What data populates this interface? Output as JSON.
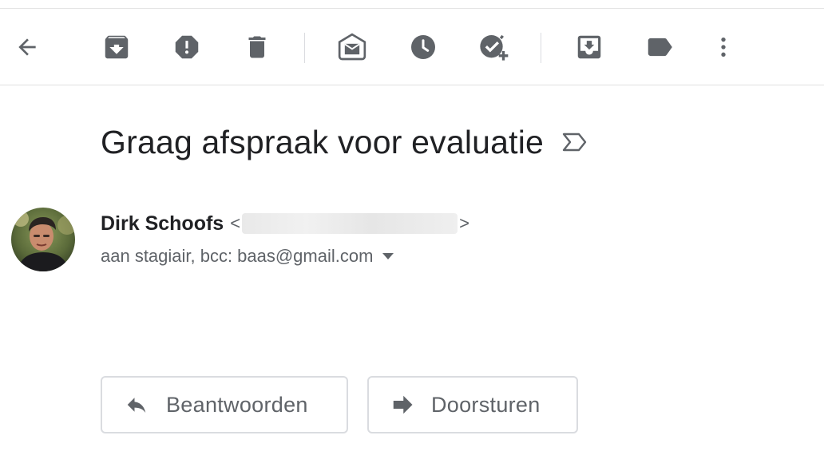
{
  "toolbar": {
    "back": "arrow-back-icon",
    "archive": "archive-icon",
    "report_spam": "report-spam-icon",
    "delete": "trash-icon",
    "mark_unread": "mark-unread-icon",
    "snooze": "snooze-clock-icon",
    "add_task": "add-to-tasks-icon",
    "move_to": "move-to-inbox-icon",
    "labels": "label-icon",
    "more": "more-vertical-icon"
  },
  "message": {
    "subject": "Graag afspraak voor evaluatie",
    "importance_marker": "importance-marker-icon",
    "sender": {
      "name": "Dirk Schoofs",
      "email_open": "<",
      "email_close": ">"
    },
    "recipients": {
      "to_text": "aan stagiair, bcc:",
      "bcc_address": "baas@gmail.com"
    }
  },
  "actions": {
    "reply_label": "Beantwoorden",
    "forward_label": "Doorsturen"
  },
  "colors": {
    "icon": "#5f6368",
    "text": "#202124",
    "secondary_text": "#5f6368",
    "border": "#dadce0"
  }
}
